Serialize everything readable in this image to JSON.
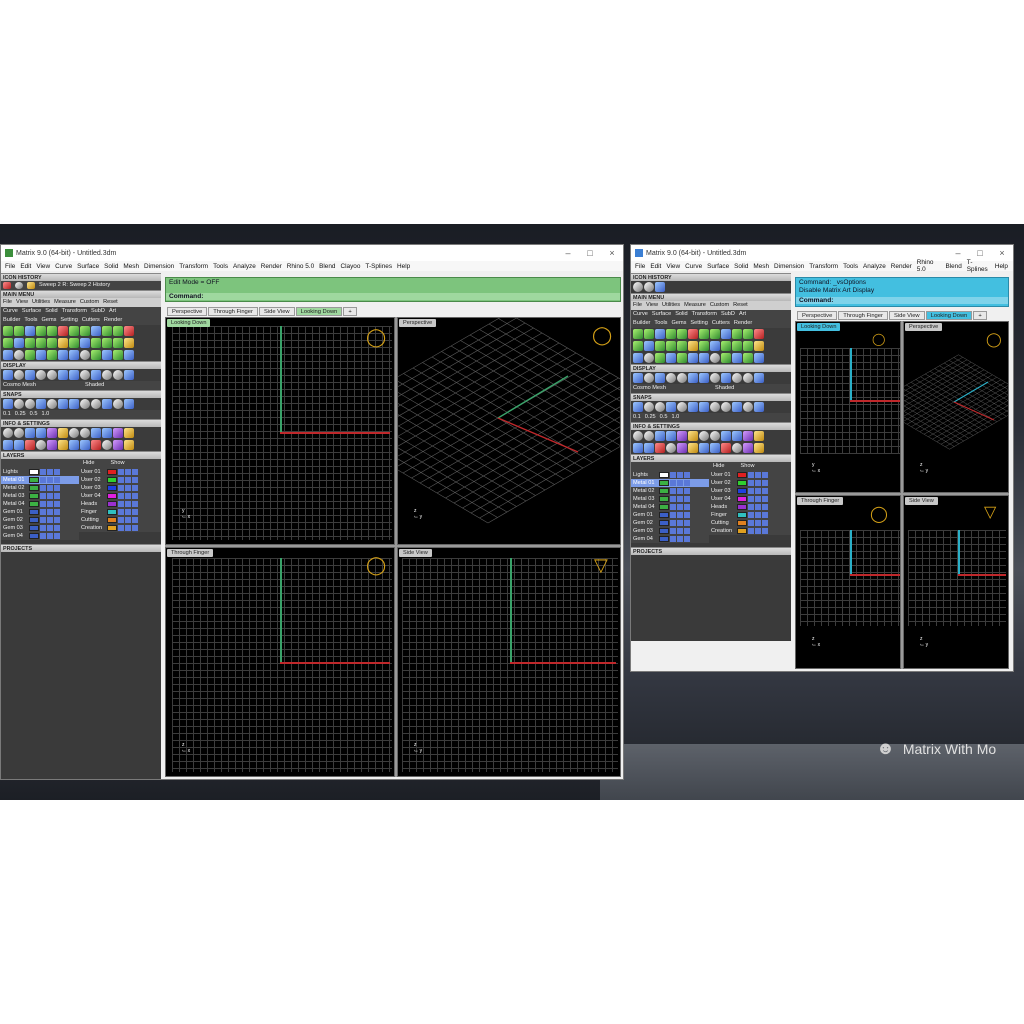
{
  "left_window": {
    "title": "Matrix 9.0 (64-bit) - Untitled.3dm",
    "menu": [
      "File",
      "Edit",
      "View",
      "Curve",
      "Surface",
      "Solid",
      "Mesh",
      "Dimension",
      "Transform",
      "Tools",
      "Analyze",
      "Render",
      "Rhino 5.0",
      "Blend",
      "Clayoo",
      "T-Splines",
      "Help"
    ],
    "icon_history": "ICON HISTORY",
    "history_text": "Sweep 2 R: Sweep 2 History",
    "main_menu": "MAIN MENU",
    "submenu": [
      "File",
      "View",
      "Utilities",
      "Measure",
      "Custom",
      "Reset"
    ],
    "cat_row1": [
      "Curve",
      "Surface",
      "Solid",
      "Transform",
      "SubD",
      "Art"
    ],
    "cat_row2": [
      "Builder",
      "Tools",
      "Gems",
      "Setting",
      "Cutters",
      "Render"
    ],
    "display": "DISPLAY",
    "display_sub": [
      "Cosmo Mesh",
      "Shaded"
    ],
    "snaps": "SNAPS",
    "snap_values": [
      "0.1",
      "0.25",
      "0.5",
      "1.0"
    ],
    "info": "INFO & SETTINGS",
    "layers_head": "LAYERS",
    "layers_hide": "Hide",
    "layers_show": "Show",
    "layers_left": [
      "Lights",
      "Metal 01",
      "Metal 02",
      "Metal 03",
      "Metal 04",
      "Gem 01",
      "Gem 02",
      "Gem 03",
      "Gem 04"
    ],
    "layers_right": [
      "User 01",
      "User 02",
      "User 03",
      "User 04",
      "Heads",
      "Finger",
      "Cutting",
      "Creation"
    ],
    "projects": "PROJECTS",
    "edit_mode": "Edit Mode = OFF",
    "command": "Command:",
    "tabs": [
      "Perspective",
      "Through Finger",
      "Side View",
      "Looking Down"
    ],
    "viewports": [
      "Looking Down",
      "Perspective",
      "Through Finger",
      "Side View"
    ]
  },
  "right_window": {
    "title": "Matrix 9.0 (64-bit) - Untitled.3dm",
    "menu": [
      "File",
      "Edit",
      "View",
      "Curve",
      "Surface",
      "Solid",
      "Mesh",
      "Dimension",
      "Transform",
      "Tools",
      "Analyze",
      "Render",
      "Rhino 5.0",
      "Blend",
      "T-Splines",
      "Help"
    ],
    "command_line1": "Command: _vsOptions",
    "command_line2": "Disable Matrix Art Display",
    "command": "Command:",
    "tabs": [
      "Perspective",
      "Through Finger",
      "Side View",
      "Looking Down"
    ],
    "viewports": [
      "Looking Down",
      "Perspective",
      "Through Finger",
      "Side View"
    ]
  },
  "watermark": "Matrix With Mo",
  "colors": {
    "x_axis": "#c0282b",
    "y_axis": "#3aa36a",
    "accent": "#7c9ce8",
    "ring": "#d4a017"
  }
}
